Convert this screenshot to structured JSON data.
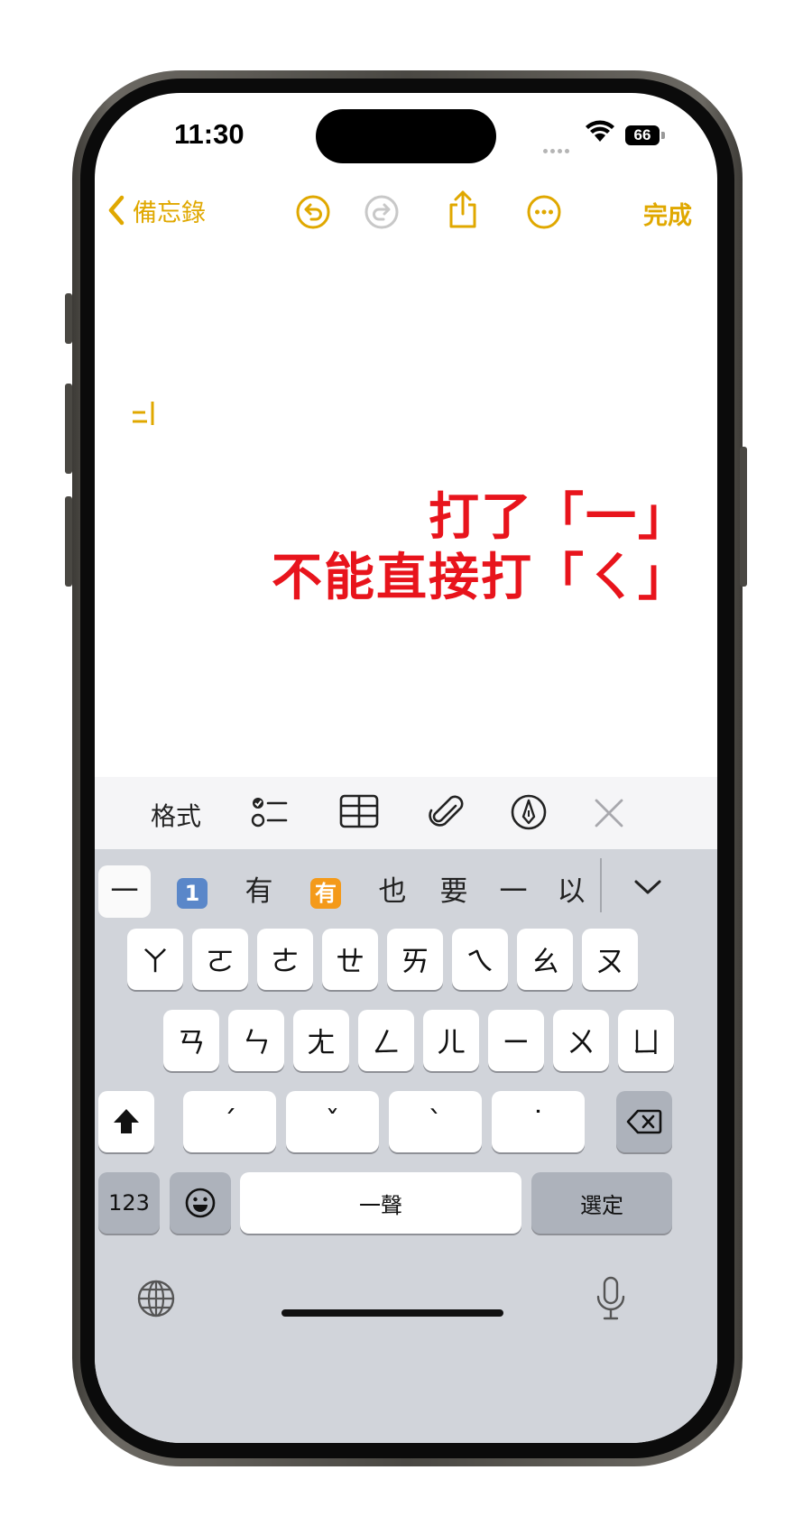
{
  "status_bar": {
    "time": "11:30",
    "battery": "66"
  },
  "nav": {
    "back_label": "備忘錄",
    "done_label": "完成"
  },
  "note": {
    "annotation_line1": "打了「一」",
    "annotation_line2": "不能直接打「ㄑ」"
  },
  "toolbar": {
    "format_label": "格式"
  },
  "candidates": [
    {
      "text": "一"
    },
    {
      "text": "1",
      "emoji": true,
      "color": "#5a87c9"
    },
    {
      "text": "有"
    },
    {
      "text": "有",
      "emoji": true,
      "color": "#f49a1a"
    },
    {
      "text": "也"
    },
    {
      "text": "要"
    },
    {
      "text": "一"
    },
    {
      "text": "以"
    }
  ],
  "keys": {
    "row1": [
      "ㄚ",
      "ㄛ",
      "ㄜ",
      "ㄝ",
      "ㄞ",
      "ㄟ",
      "ㄠ",
      "ㄡ"
    ],
    "row2": [
      "ㄢ",
      "ㄣ",
      "ㄤ",
      "ㄥ",
      "ㄦ",
      "ㄧ",
      "ㄨ",
      "ㄩ"
    ],
    "row3": [
      "ˊ",
      "ˇ",
      "ˋ",
      "˙"
    ],
    "num_label": "123",
    "space_label": "一聲",
    "select_label": "選定"
  },
  "colors": {
    "accent": "#e0a800",
    "annotation": "#e8141c"
  }
}
